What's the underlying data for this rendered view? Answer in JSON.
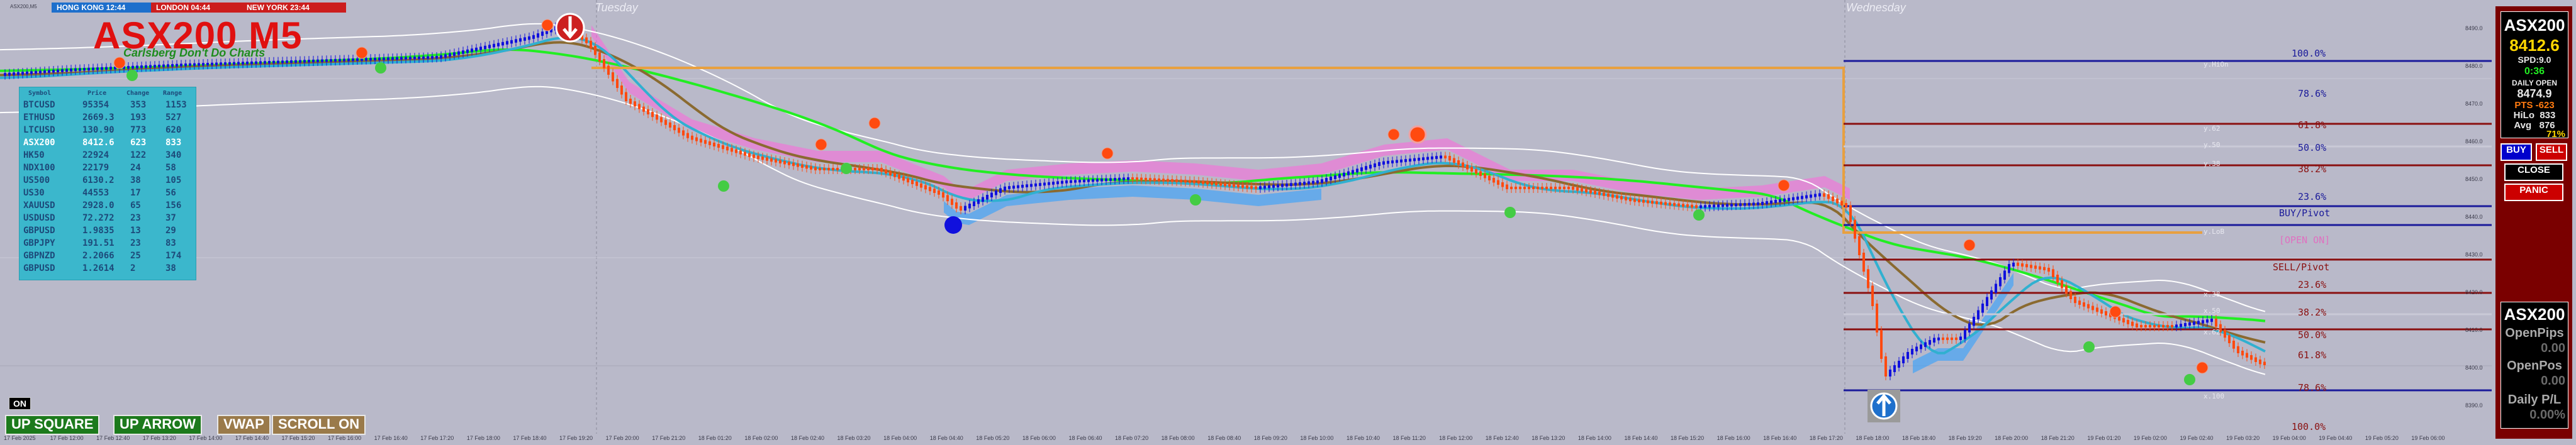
{
  "window": {
    "symbol_caption": "ASX200,M5"
  },
  "sessions": [
    {
      "label": "HONG KONG 12:44",
      "color": "#1d6fcc"
    },
    {
      "label": "LONDON  04:44",
      "color": "#cc1d1d"
    },
    {
      "label": "NEW YORK 23:44",
      "color": "#cc1d1d"
    }
  ],
  "chart_title": "ASX200 M5",
  "chart_subtitle": "Carlsberg Don't Do Charts",
  "day_labels": {
    "tuesday": "Tuesday",
    "wednesday": "Wednesday"
  },
  "symbol_table": {
    "headers": [
      "Symbol",
      "Price",
      "Change",
      "Range"
    ],
    "rows": [
      {
        "symbol": "BTCUSD",
        "price": "95354",
        "change": "353",
        "range": "1153",
        "color": "#1d4a7a"
      },
      {
        "symbol": "ETHUSD",
        "price": "2669.3",
        "change": "193",
        "range": "527",
        "color": "#1d4a7a"
      },
      {
        "symbol": "LTCUSD",
        "price": "130.90",
        "change": "773",
        "range": "620",
        "color": "#1d4a7a"
      },
      {
        "symbol": "ASX200",
        "price": "8412.6",
        "change": "623",
        "range": "833",
        "color": "#ffffff"
      },
      {
        "symbol": "HK50",
        "price": "22924",
        "change": "122",
        "range": "340",
        "color": "#1d4a7a"
      },
      {
        "symbol": "NDX100",
        "price": "22179",
        "change": "24",
        "range": "58",
        "color": "#1d4a7a"
      },
      {
        "symbol": "US500",
        "price": "6130.2",
        "change": "38",
        "range": "105",
        "color": "#1d4a7a"
      },
      {
        "symbol": "US30",
        "price": "44553",
        "change": "17",
        "range": "56",
        "color": "#1d4a7a"
      },
      {
        "symbol": "XAUUSD",
        "price": "2928.0",
        "change": "65",
        "range": "156",
        "color": "#1d4a7a"
      },
      {
        "symbol": "USDUSD",
        "price": "72.272",
        "change": "23",
        "range": "37",
        "color": "#1d4a7a"
      },
      {
        "symbol": "GBPUSD",
        "price": "1.9835",
        "change": "13",
        "range": "29",
        "color": "#1d4a7a"
      },
      {
        "symbol": "GBPJPY",
        "price": "191.51",
        "change": "23",
        "range": "83",
        "color": "#1d4a7a"
      },
      {
        "symbol": "GBPNZD",
        "price": "2.2066",
        "change": "25",
        "range": "174",
        "color": "#1d4a7a"
      },
      {
        "symbol": "GBPUSD",
        "price": "1.2614",
        "change": "2",
        "range": "38",
        "color": "#1d4a7a"
      }
    ]
  },
  "bottom_buttons": {
    "on_label": "ON",
    "up_square": "UP SQUARE",
    "up_arrow": "UP ARROW",
    "vwap": "VWAP",
    "scroll_on": "SCROLL ON"
  },
  "fib_right": [
    {
      "label": "100.0%",
      "color": "#1a1a9a"
    },
    {
      "label": "78.6%",
      "color": "#1a1a9a"
    },
    {
      "label": "61.8%",
      "color": "#8a1010"
    },
    {
      "label": "50.0%",
      "color": "#1a1a9a"
    },
    {
      "label": "38.2%",
      "color": "#8a1010"
    },
    {
      "label": "23.6%",
      "color": "#1a1a9a"
    },
    {
      "label": "BUY/Pivot",
      "color": "#1a1a9a"
    },
    {
      "label": "[OPEN ON]",
      "color": "#e070c0"
    },
    {
      "label": "SELL/Pivot",
      "color": "#8a1010"
    },
    {
      "label": "23.6%",
      "color": "#8a1010"
    },
    {
      "label": "38.2%",
      "color": "#8a1010"
    },
    {
      "label": "50.0%",
      "color": "#8a1010"
    },
    {
      "label": "61.8%",
      "color": "#8a1010"
    },
    {
      "label": "78.6%",
      "color": "#8a1010"
    },
    {
      "label": "100.0%",
      "color": "#8a1010"
    }
  ],
  "fib_small": [
    "y.HiOn",
    "y.62",
    "y.50",
    "y.38",
    "y.LoB",
    "x.38",
    "x.50",
    "x.62",
    "x.100"
  ],
  "right_panel": {
    "symbol": "ASX200",
    "price": "8412.6",
    "spd": "SPD:9.0",
    "timer": "0:36",
    "daily_open_label": "DAILY OPEN",
    "daily_open": "8474.9",
    "pts": "PTS -623",
    "hilo": "HiLo  833",
    "avg": "Avg   876",
    "pct": "71%",
    "buy": "BUY",
    "sell": "SELL",
    "close": "CLOSE",
    "panic": "PANIC",
    "stats_symbol": "ASX200",
    "open_pips_label": "OpenPips",
    "open_pips": "0.00",
    "open_pos_label": "OpenPos",
    "open_pos": "0.00",
    "daily_pl_label": "Daily P/L",
    "daily_pl": "0.00%"
  },
  "price_scale": [
    "8490.0",
    "8480.0",
    "8470.0",
    "8460.0",
    "8450.0",
    "8440.0",
    "8430.0",
    "8420.0",
    "8410.0",
    "8400.0",
    "8390.0"
  ],
  "time_ticks": [
    "17 Feb 2025",
    "17 Feb 12:00",
    "17 Feb 12:40",
    "17 Feb 13:20",
    "17 Feb 14:00",
    "17 Feb 14:40",
    "17 Feb 15:20",
    "17 Feb 16:00",
    "17 Feb 16:40",
    "17 Feb 17:20",
    "17 Feb 18:00",
    "17 Feb 18:40",
    "17 Feb 19:20",
    "17 Feb 20:00",
    "17 Feb 21:20",
    "18 Feb 01:20",
    "18 Feb 02:00",
    "18 Feb 02:40",
    "18 Feb 03:20",
    "18 Feb 04:00",
    "18 Feb 04:40",
    "18 Feb 05:20",
    "18 Feb 06:00",
    "18 Feb 06:40",
    "18 Feb 07:20",
    "18 Feb 08:00",
    "18 Feb 08:40",
    "18 Feb 09:20",
    "18 Feb 10:00",
    "18 Feb 10:40",
    "18 Feb 11:20",
    "18 Feb 12:00",
    "18 Feb 12:40",
    "18 Feb 13:20",
    "18 Feb 14:00",
    "18 Feb 14:40",
    "18 Feb 15:20",
    "18 Feb 16:00",
    "18 Feb 16:40",
    "18 Feb 17:20",
    "18 Feb 18:00",
    "18 Feb 18:40",
    "18 Feb 19:20",
    "18 Feb 20:00",
    "18 Feb 21:20",
    "19 Feb 01:20",
    "19 Feb 02:00",
    "19 Feb 02:40",
    "19 Feb 03:20",
    "19 Feb 04:00",
    "19 Feb 04:40",
    "19 Feb 05:20",
    "19 Feb 06:00"
  ],
  "colors": {
    "background": "#b9b9c9",
    "bull": "#1010dd",
    "bear": "#ff4a10",
    "ema_green": "#22ee22",
    "ema_brown": "#8a6a30",
    "ema_cyan": "#30b0d0",
    "band_white": "#ffffff",
    "cloud_pink": "#ff66dd",
    "cloud_blue": "#30a0ff",
    "level_orange": "#e8a040",
    "panel_red": "#7a0000"
  }
}
